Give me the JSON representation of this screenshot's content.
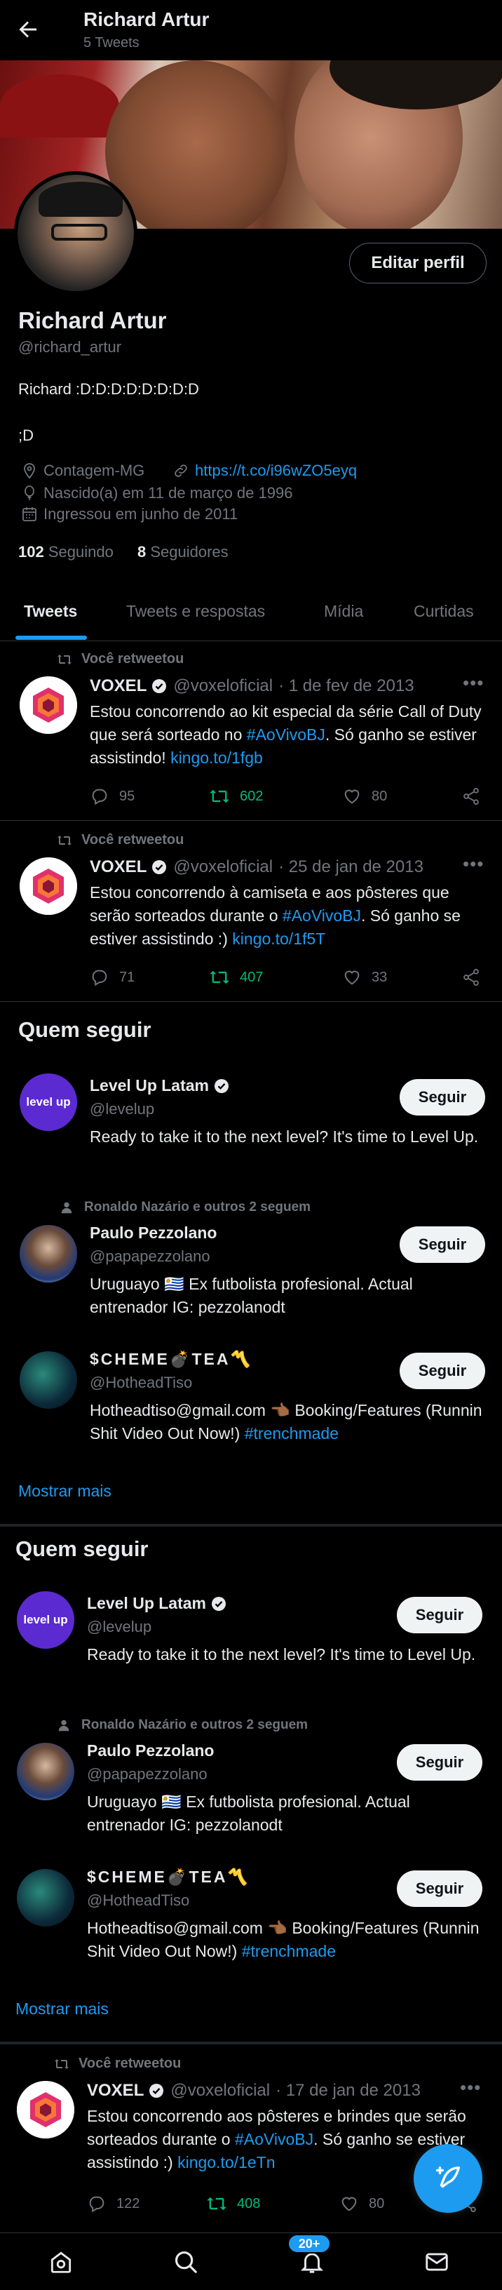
{
  "header": {
    "title": "Richard Artur",
    "tweet_count": "5 Tweets"
  },
  "profile": {
    "edit_label": "Editar perfil",
    "name": "Richard Artur",
    "handle": "@richard_artur",
    "bio_line1": "Richard :D:D:D:D:D:D:D:D",
    "bio_line2": ";D",
    "location": "Contagem-MG",
    "website": "https://t.co/i96wZO5eyq",
    "birth": "Nascido(a) em 11 de março de 1996",
    "joined": "Ingressou em junho de 2011",
    "following_count": "102",
    "following_label": "Seguindo",
    "followers_count": "8",
    "followers_label": "Seguidores"
  },
  "tabs": [
    "Tweets",
    "Tweets e respostas",
    "Mídia",
    "Curtidas"
  ],
  "retweet_label": "Você retweetou",
  "tweets": [
    {
      "name": "VOXEL",
      "handle": "@voxeloficial",
      "date": "· 1 de fev de 2013",
      "text_pre": "Estou concorrendo ao kit especial da série Call of Duty que será sorteado no ",
      "hashtag": "#AoVivoBJ",
      "text_mid": ". Só ganho se estiver assistindo! ",
      "link": "kingo.to/1fgb",
      "replies": "95",
      "retweets": "602",
      "likes": "80"
    },
    {
      "name": "VOXEL",
      "handle": "@voxeloficial",
      "date": "· 25 de jan de 2013",
      "text_pre": "Estou concorrendo à camiseta e aos pôsteres que serão sorteados durante o ",
      "hashtag": "#AoVivoBJ",
      "text_mid": ". Só ganho se estiver assistindo :) ",
      "link": "kingo.to/1f5T",
      "replies": "71",
      "retweets": "407",
      "likes": "33"
    },
    {
      "name": "VOXEL",
      "handle": "@voxeloficial",
      "date": "· 17 de jan de 2013",
      "text_pre": "Estou concorrendo aos pôsteres e brindes que serão sorteados durante o ",
      "hashtag": "#AoVivoBJ",
      "text_mid": ". Só ganho se estiver assistindo :) ",
      "link": "kingo.to/1eTn",
      "replies": "122",
      "retweets": "408",
      "likes": "80"
    }
  ],
  "who_to_follow": {
    "title": "Quem seguir",
    "follow_label": "Seguir",
    "show_more": "Mostrar mais",
    "accounts": [
      {
        "name": "Level Up Latam",
        "handle": "@levelup",
        "bio": "Ready to take it to the next level? It's time to Level Up.",
        "context": "",
        "avatar_text": "level up"
      },
      {
        "name": "Paulo Pezzolano",
        "handle": "@papapezzolano",
        "bio": "Uruguayo 🇺🇾 Ex futbolista profesional. Actual entrenador IG: pezzolanodt",
        "context": "Ronaldo Nazário e outros 2 seguem"
      },
      {
        "name": "$CHEME💣TEA〽️",
        "handle": "@HotheadTiso",
        "bio_pre": "Hotheadtiso@gmail.com 👈🏾 Booking/Features (Runnin Shit Video Out Now!) ",
        "bio_tag": "#trenchmade",
        "context": ""
      }
    ]
  },
  "bottom_nav": {
    "notification_badge": "20+"
  },
  "colors": {
    "accent": "#1d9bf0",
    "retweet_green": "#00ba7c",
    "muted": "#71767b",
    "background": "#000000"
  }
}
